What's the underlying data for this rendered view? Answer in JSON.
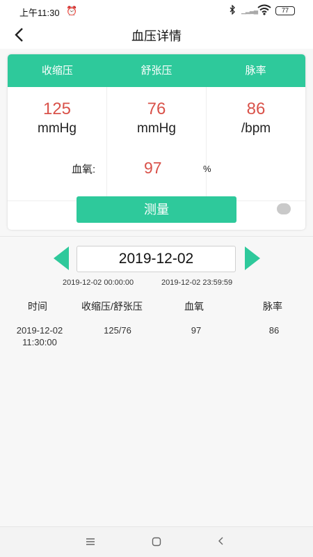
{
  "status_bar": {
    "time": "上午11:30",
    "battery": "77"
  },
  "header": {
    "title": "血压详情"
  },
  "card": {
    "columns": [
      "收缩压",
      "舒张压",
      "脉率"
    ],
    "systolic": {
      "value": "125",
      "unit": "mmHg"
    },
    "diastolic": {
      "value": "76",
      "unit": "mmHg"
    },
    "pulse": {
      "value": "86",
      "unit": "/bpm"
    },
    "spo2": {
      "label": "血氧:",
      "value": "97",
      "unit": "%"
    },
    "measure_button": "测量"
  },
  "date_picker": {
    "date": "2019-12-02",
    "range_start": "2019-12-02 00:00:00",
    "range_end": "2019-12-02 23:59:59"
  },
  "table": {
    "headers": [
      "时间",
      "收缩压/舒张压",
      "血氧",
      "脉率"
    ],
    "rows": [
      {
        "time_date": "2019-12-02",
        "time_clock": "11:30:00",
        "bp": "125/76",
        "spo2": "97",
        "pulse": "86"
      }
    ]
  },
  "icons": {
    "back": "chevron-left-icon",
    "nav_menu": "menu-icon",
    "nav_home": "home-icon",
    "nav_back": "back-icon"
  },
  "colors": {
    "accent": "#2ec99b",
    "value_red": "#d9524a"
  }
}
